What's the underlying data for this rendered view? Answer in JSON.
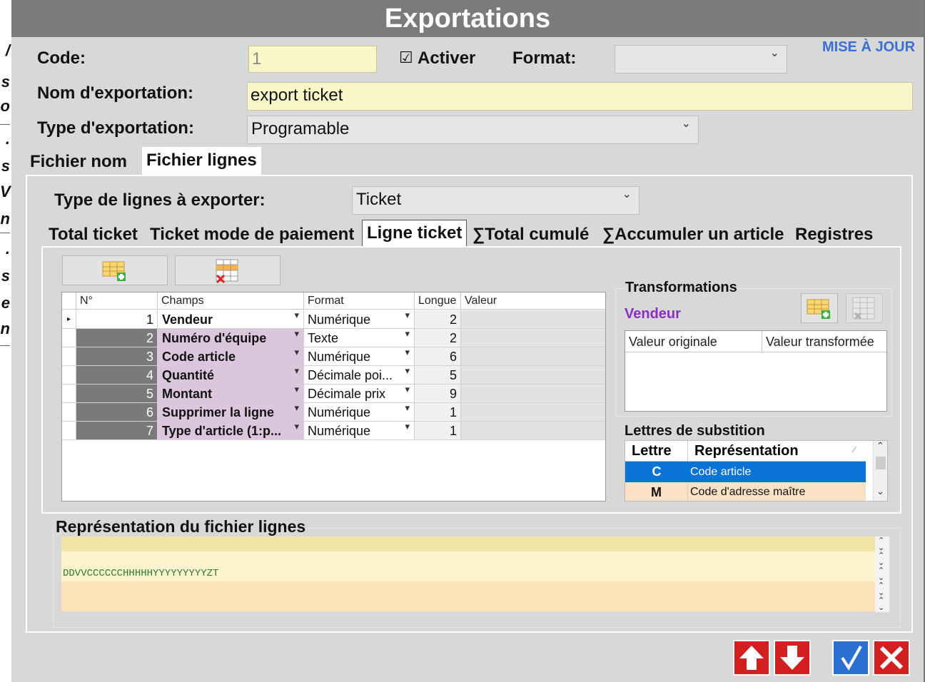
{
  "window": {
    "title": "Exportations"
  },
  "bg_glyphs": [
    "/",
    "s",
    "o",
    ".",
    "s",
    "V",
    "n",
    ".",
    "s",
    "e",
    "n"
  ],
  "header": {
    "code_label": "Code:",
    "code_value": "1",
    "activer_checkbox": "☑",
    "activer_label": "Activer",
    "format_label": "Format:",
    "format_value": "",
    "update_link": "MISE À JOUR",
    "name_label": "Nom d'exportation:",
    "name_value": "export ticket",
    "type_label": "Type d'exportation:",
    "type_value": "Programable"
  },
  "tabs": [
    {
      "label": "Fichier nom",
      "active": false
    },
    {
      "label": "Fichier lignes",
      "active": true
    }
  ],
  "lines": {
    "type_label": "Type de lignes à exporter:",
    "type_value": "Ticket",
    "subtabs": [
      {
        "label": "Total ticket",
        "active": false
      },
      {
        "label": "Ticket mode de paiement",
        "active": false
      },
      {
        "label": "Ligne ticket",
        "active": true
      },
      {
        "label": "∑Total cumulé",
        "active": false
      },
      {
        "label": "∑Accumuler un article",
        "active": false
      },
      {
        "label": "Registres",
        "active": false
      }
    ]
  },
  "grid": {
    "columns": [
      "N°",
      "Champs",
      "Format",
      "Longue",
      "Valeur"
    ],
    "row_indicator": "▸",
    "rows": [
      {
        "num": "1",
        "field": "Vendeur",
        "format": "Numérique",
        "length": "2",
        "value": ""
      },
      {
        "num": "2",
        "field": "Numéro d'équipe",
        "format": "Texte",
        "length": "2",
        "value": ""
      },
      {
        "num": "3",
        "field": "Code article",
        "format": "Numérique",
        "length": "6",
        "value": ""
      },
      {
        "num": "4",
        "field": "Quantité",
        "format": "Décimale poi...",
        "length": "5",
        "value": ""
      },
      {
        "num": "5",
        "field": "Montant",
        "format": "Décimale prix",
        "length": "9",
        "value": ""
      },
      {
        "num": "6",
        "field": "Supprimer la ligne",
        "format": "Numérique",
        "length": "1",
        "value": ""
      },
      {
        "num": "7",
        "field": "Type d'article (1:p...",
        "format": "Numérique",
        "length": "1",
        "value": ""
      }
    ]
  },
  "transformations": {
    "title": "Transformations",
    "field": "Vendeur",
    "columns": [
      "Valeur originale",
      "Valeur transformée"
    ]
  },
  "substitution": {
    "title": "Lettres de substition",
    "columns": [
      "Lettre",
      "Représentation"
    ],
    "sort_glyph": "⁄",
    "rows": [
      {
        "letter": "C",
        "text": "Code article",
        "selected": true
      },
      {
        "letter": "M",
        "text": "Code d'adresse maître",
        "selected": false
      }
    ]
  },
  "representation": {
    "title": "Représentation du fichier lignes",
    "lines": [
      "",
      "",
      "DDVVCCCCCCHHHHHYYYYYYYYYZT",
      "",
      ""
    ],
    "row_colors": [
      "#f0e3a6",
      "#fdf4cf",
      "#fdf4cf",
      "#fbe2b9",
      "#fbe2b9"
    ]
  },
  "colors": {
    "accent_purple": "#8a2fc4",
    "selection_blue": "#0a73d6",
    "link_blue": "#3b6fd6"
  }
}
